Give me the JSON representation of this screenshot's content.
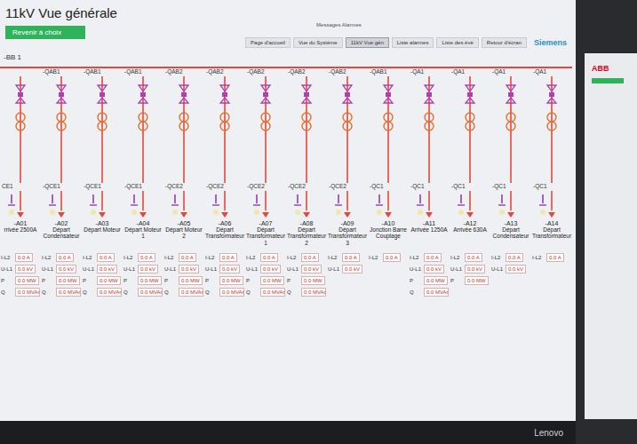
{
  "window": {
    "title": "11kV Vue générale"
  },
  "back_button": "Revenir à choix",
  "alarm_label": "Messages Alarmes",
  "nav": [
    {
      "label": "Page d'accueil",
      "selected": false
    },
    {
      "label": "Vue du Système",
      "selected": false
    },
    {
      "label": "11kV Vue gén",
      "selected": true
    },
    {
      "label": "Liste alarmes",
      "selected": false
    },
    {
      "label": "Liste des évé",
      "selected": false
    },
    {
      "label": "Retour d'écran",
      "selected": false
    }
  ],
  "brand": "Siemens",
  "bus": "-BB 1",
  "feeders": [
    {
      "earth": "CE1",
      "id": "-A01",
      "name": "rrivée 2500A",
      "measures": [
        {
          "label": "I-L2",
          "value": "0.0 A"
        },
        {
          "label": "U-L1",
          "value": "0.0 kV"
        },
        {
          "label": "P",
          "value": "0.0 MW"
        },
        {
          "label": "Q",
          "value": "0.0 MVAr"
        }
      ]
    },
    {
      "bay": "-QAB1",
      "earth": "-QCE1",
      "id": "-A02",
      "name": "Départ Condensateur",
      "measures": [
        {
          "label": "I-L2",
          "value": "0.0 A"
        },
        {
          "label": "U-L1",
          "value": "0.0 kV"
        },
        {
          "label": "P",
          "value": "0.0 MW"
        },
        {
          "label": "Q",
          "value": "0.0 MVAr"
        }
      ]
    },
    {
      "bay": "-QAB1",
      "earth": "-QCE1",
      "id": "-A03",
      "name": "Départ Moteur",
      "measures": [
        {
          "label": "I-L2",
          "value": "0.0 A"
        },
        {
          "label": "U-L1",
          "value": "0.0 kV"
        },
        {
          "label": "P",
          "value": "0.0 MW"
        },
        {
          "label": "Q",
          "value": "0.0 MVAr"
        }
      ]
    },
    {
      "bay": "-QAB1",
      "earth": "-QCE1",
      "id": "-A04",
      "name": "Départ Moteur 1",
      "measures": [
        {
          "label": "I-L2",
          "value": "0.0 A"
        },
        {
          "label": "U-L1",
          "value": "0.0 kV"
        },
        {
          "label": "P",
          "value": "0.0 MW"
        },
        {
          "label": "Q",
          "value": "0.0 MVAr"
        }
      ]
    },
    {
      "bay": "-QAB2",
      "earth": "-QCE2",
      "id": "-A05",
      "name": "Départ Moteur 2",
      "measures": [
        {
          "label": "I-L2",
          "value": "0.0 A"
        },
        {
          "label": "U-L1",
          "value": "0.0 kV"
        },
        {
          "label": "P",
          "value": "0.0 MW"
        },
        {
          "label": "Q",
          "value": "0.0 MVAr"
        }
      ]
    },
    {
      "bay": "-QAB2",
      "earth": "-QCE2",
      "id": "-A06",
      "name": "Départ Transformateur",
      "measures": [
        {
          "label": "I-L2",
          "value": "0.0 A"
        },
        {
          "label": "U-L1",
          "value": "0.0 kV"
        },
        {
          "label": "P",
          "value": "0.0 MW"
        },
        {
          "label": "Q",
          "value": "0.0 MVAr"
        }
      ]
    },
    {
      "bay": "-QAB2",
      "earth": "-QCE2",
      "id": "-A07",
      "name": "Départ Transformateur 1",
      "measures": [
        {
          "label": "I-L2",
          "value": "0.0 A"
        },
        {
          "label": "U-L1",
          "value": "0.0 kV"
        },
        {
          "label": "P",
          "value": "0.0 MW"
        },
        {
          "label": "Q",
          "value": "0.0 MVAr"
        }
      ]
    },
    {
      "bay": "-QAB2",
      "earth": "-QCE2",
      "id": "-A08",
      "name": "Départ Transformateur 2",
      "measures": [
        {
          "label": "I-L2",
          "value": "0.0 A"
        },
        {
          "label": "U-L1",
          "value": "0.0 kV"
        },
        {
          "label": "P",
          "value": "0.0 MW"
        },
        {
          "label": "Q",
          "value": "0.0 MVAr"
        }
      ]
    },
    {
      "bay": "-QAB2",
      "earth": "-QCE2",
      "id": "-A09",
      "name": "Départ Transformateur 3",
      "measures": [
        {
          "label": "I-L2",
          "value": "0.0 A"
        },
        {
          "label": "U-L1",
          "value": "0.0 kV"
        }
      ]
    },
    {
      "bay": "-QAB1",
      "earth": "-QC1",
      "id": "-A10",
      "name": "Jonction Barre Couplage",
      "measures": [
        {
          "label": "I-L2",
          "value": "0.0 A"
        }
      ]
    },
    {
      "bay": "-QA1",
      "earth": "-QC1",
      "id": "-A11",
      "name": "Arrivée 1250A",
      "measures": [
        {
          "label": "I-L2",
          "value": "0.0 A"
        },
        {
          "label": "U-L1",
          "value": "0.0 kV"
        },
        {
          "label": "P",
          "value": "0.0 MW"
        },
        {
          "label": "Q",
          "value": "0.0 MVAr"
        }
      ]
    },
    {
      "bay": "-QA1",
      "earth": "-QC1",
      "id": "-A12",
      "name": "Arrivée 630A",
      "measures": [
        {
          "label": "I-L2",
          "value": "0.0 A"
        },
        {
          "label": "U-L1",
          "value": "0.0 kV"
        },
        {
          "label": "P",
          "value": "0.0 MW"
        }
      ]
    },
    {
      "bay": "-QA1",
      "earth": "-QC1",
      "id": "-A13",
      "name": "Départ Condensateur",
      "measures": [
        {
          "label": "I-L2",
          "value": "0.0 A"
        },
        {
          "label": "U-L1",
          "value": "0.0 kV"
        }
      ]
    },
    {
      "bay": "-QA1",
      "earth": "-QC1",
      "id": "-A14",
      "name": "Départ Transformateur",
      "measures": [
        {
          "label": "I-L2",
          "value": "0.0 A"
        }
      ]
    }
  ],
  "monitor_brand": "Lenovo",
  "second_screen": {
    "logo": "ABB"
  }
}
